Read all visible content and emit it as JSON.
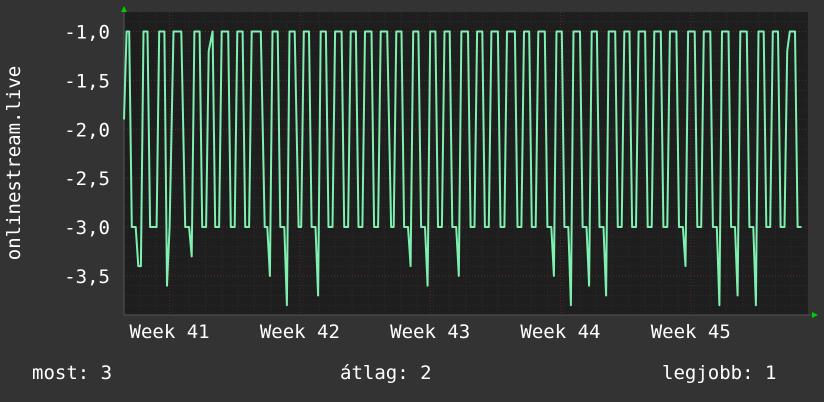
{
  "chart_data": {
    "type": "line",
    "ylabel": "onlinestream.live",
    "y_ticks": [
      {
        "value": -1.0,
        "label": "-1,0"
      },
      {
        "value": -1.5,
        "label": "-1,5"
      },
      {
        "value": -2.0,
        "label": "-2,0"
      },
      {
        "value": -2.5,
        "label": "-2,5"
      },
      {
        "value": -3.0,
        "label": "-3,0"
      },
      {
        "value": -3.5,
        "label": "-3,5"
      }
    ],
    "ylim": [
      -3.9,
      -0.8
    ],
    "xlim": [
      0,
      5.25
    ],
    "x_ticks": [
      {
        "value": 0.35,
        "label": "Week 41"
      },
      {
        "value": 1.35,
        "label": "Week 42"
      },
      {
        "value": 2.35,
        "label": "Week 43"
      },
      {
        "value": 3.35,
        "label": "Week 44"
      },
      {
        "value": 4.35,
        "label": "Week 45"
      }
    ],
    "grid": true,
    "colors": {
      "background": "#333333",
      "plot": "#1e1e1e",
      "line": "#7ef0b0",
      "grid_major": "#5a2a2a",
      "grid_minor": "#2c2c2c",
      "axis_arrow": "#00cc00"
    },
    "series": [
      {
        "values": [
          [
            0.0,
            -1.9
          ],
          [
            0.02,
            -1.0
          ],
          [
            0.04,
            -1.0
          ],
          [
            0.06,
            -3.0
          ],
          [
            0.09,
            -3.0
          ],
          [
            0.11,
            -3.4
          ],
          [
            0.13,
            -3.4
          ],
          [
            0.15,
            -1.0
          ],
          [
            0.18,
            -1.0
          ],
          [
            0.2,
            -3.0
          ],
          [
            0.25,
            -3.0
          ],
          [
            0.27,
            -1.0
          ],
          [
            0.31,
            -1.0
          ],
          [
            0.33,
            -3.6
          ],
          [
            0.35,
            -3.0
          ],
          [
            0.38,
            -1.0
          ],
          [
            0.44,
            -1.0
          ],
          [
            0.47,
            -3.0
          ],
          [
            0.5,
            -3.0
          ],
          [
            0.52,
            -3.3
          ],
          [
            0.54,
            -1.0
          ],
          [
            0.58,
            -1.0
          ],
          [
            0.6,
            -3.0
          ],
          [
            0.63,
            -3.0
          ],
          [
            0.65,
            -1.2
          ],
          [
            0.68,
            -1.0
          ],
          [
            0.7,
            -3.0
          ],
          [
            0.73,
            -3.0
          ],
          [
            0.75,
            -1.0
          ],
          [
            0.8,
            -1.0
          ],
          [
            0.82,
            -3.0
          ],
          [
            0.85,
            -3.0
          ],
          [
            0.87,
            -1.0
          ],
          [
            0.91,
            -1.0
          ],
          [
            0.93,
            -3.0
          ],
          [
            0.96,
            -3.0
          ],
          [
            0.98,
            -1.0
          ],
          [
            1.05,
            -1.0
          ],
          [
            1.08,
            -3.0
          ],
          [
            1.1,
            -3.0
          ],
          [
            1.12,
            -3.5
          ],
          [
            1.14,
            -1.0
          ],
          [
            1.18,
            -1.0
          ],
          [
            1.2,
            -3.0
          ],
          [
            1.23,
            -3.0
          ],
          [
            1.25,
            -3.8
          ],
          [
            1.27,
            -1.0
          ],
          [
            1.31,
            -1.0
          ],
          [
            1.34,
            -3.0
          ],
          [
            1.36,
            -3.0
          ],
          [
            1.38,
            -1.0
          ],
          [
            1.42,
            -1.0
          ],
          [
            1.44,
            -3.0
          ],
          [
            1.47,
            -3.0
          ],
          [
            1.49,
            -3.7
          ],
          [
            1.51,
            -1.0
          ],
          [
            1.55,
            -1.0
          ],
          [
            1.57,
            -3.0
          ],
          [
            1.6,
            -3.0
          ],
          [
            1.62,
            -1.0
          ],
          [
            1.67,
            -1.0
          ],
          [
            1.69,
            -3.0
          ],
          [
            1.72,
            -3.0
          ],
          [
            1.74,
            -1.0
          ],
          [
            1.78,
            -1.0
          ],
          [
            1.8,
            -3.0
          ],
          [
            1.83,
            -3.0
          ],
          [
            1.85,
            -1.0
          ],
          [
            1.9,
            -1.0
          ],
          [
            1.92,
            -3.0
          ],
          [
            1.95,
            -3.0
          ],
          [
            1.97,
            -1.0
          ],
          [
            2.02,
            -1.0
          ],
          [
            2.05,
            -3.0
          ],
          [
            2.07,
            -3.0
          ],
          [
            2.09,
            -1.0
          ],
          [
            2.13,
            -1.0
          ],
          [
            2.15,
            -3.0
          ],
          [
            2.18,
            -3.0
          ],
          [
            2.2,
            -3.4
          ],
          [
            2.22,
            -1.0
          ],
          [
            2.26,
            -1.0
          ],
          [
            2.28,
            -3.0
          ],
          [
            2.31,
            -3.0
          ],
          [
            2.33,
            -3.6
          ],
          [
            2.35,
            -1.0
          ],
          [
            2.39,
            -1.0
          ],
          [
            2.41,
            -3.0
          ],
          [
            2.44,
            -3.0
          ],
          [
            2.46,
            -1.0
          ],
          [
            2.5,
            -1.0
          ],
          [
            2.52,
            -3.0
          ],
          [
            2.55,
            -3.0
          ],
          [
            2.57,
            -3.5
          ],
          [
            2.59,
            -1.0
          ],
          [
            2.64,
            -1.0
          ],
          [
            2.66,
            -3.0
          ],
          [
            2.69,
            -3.0
          ],
          [
            2.71,
            -1.0
          ],
          [
            2.75,
            -1.0
          ],
          [
            2.77,
            -3.0
          ],
          [
            2.8,
            -3.0
          ],
          [
            2.82,
            -1.0
          ],
          [
            2.87,
            -1.0
          ],
          [
            2.89,
            -3.0
          ],
          [
            2.92,
            -3.0
          ],
          [
            2.94,
            -1.0
          ],
          [
            3.0,
            -1.0
          ],
          [
            3.02,
            -3.0
          ],
          [
            3.05,
            -3.0
          ],
          [
            3.07,
            -1.0
          ],
          [
            3.11,
            -1.0
          ],
          [
            3.13,
            -3.0
          ],
          [
            3.16,
            -3.0
          ],
          [
            3.18,
            -1.0
          ],
          [
            3.23,
            -1.0
          ],
          [
            3.25,
            -3.0
          ],
          [
            3.28,
            -3.0
          ],
          [
            3.3,
            -3.5
          ],
          [
            3.32,
            -1.0
          ],
          [
            3.36,
            -1.0
          ],
          [
            3.38,
            -3.0
          ],
          [
            3.41,
            -3.0
          ],
          [
            3.43,
            -3.8
          ],
          [
            3.45,
            -1.0
          ],
          [
            3.5,
            -1.0
          ],
          [
            3.52,
            -3.0
          ],
          [
            3.55,
            -3.0
          ],
          [
            3.57,
            -3.6
          ],
          [
            3.59,
            -1.0
          ],
          [
            3.63,
            -1.0
          ],
          [
            3.65,
            -3.0
          ],
          [
            3.68,
            -3.0
          ],
          [
            3.7,
            -3.7
          ],
          [
            3.72,
            -1.0
          ],
          [
            3.77,
            -1.0
          ],
          [
            3.79,
            -3.0
          ],
          [
            3.82,
            -3.0
          ],
          [
            3.84,
            -1.0
          ],
          [
            3.88,
            -1.0
          ],
          [
            3.9,
            -3.0
          ],
          [
            3.93,
            -3.0
          ],
          [
            3.95,
            -1.0
          ],
          [
            4.0,
            -1.0
          ],
          [
            4.02,
            -3.0
          ],
          [
            4.05,
            -3.0
          ],
          [
            4.07,
            -1.0
          ],
          [
            4.12,
            -1.0
          ],
          [
            4.14,
            -3.0
          ],
          [
            4.17,
            -3.0
          ],
          [
            4.19,
            -1.0
          ],
          [
            4.24,
            -1.0
          ],
          [
            4.26,
            -3.0
          ],
          [
            4.29,
            -3.0
          ],
          [
            4.31,
            -3.4
          ],
          [
            4.33,
            -1.0
          ],
          [
            4.38,
            -1.0
          ],
          [
            4.4,
            -3.0
          ],
          [
            4.43,
            -3.0
          ],
          [
            4.45,
            -1.0
          ],
          [
            4.5,
            -1.0
          ],
          [
            4.52,
            -3.0
          ],
          [
            4.55,
            -3.0
          ],
          [
            4.57,
            -3.8
          ],
          [
            4.59,
            -1.0
          ],
          [
            4.64,
            -1.0
          ],
          [
            4.66,
            -3.0
          ],
          [
            4.69,
            -3.0
          ],
          [
            4.71,
            -3.7
          ],
          [
            4.73,
            -1.0
          ],
          [
            4.78,
            -1.0
          ],
          [
            4.8,
            -3.0
          ],
          [
            4.83,
            -3.0
          ],
          [
            4.85,
            -3.8
          ],
          [
            4.87,
            -1.0
          ],
          [
            4.91,
            -1.0
          ],
          [
            4.93,
            -3.0
          ],
          [
            4.96,
            -3.0
          ],
          [
            4.98,
            -1.0
          ],
          [
            5.02,
            -1.0
          ],
          [
            5.04,
            -3.0
          ],
          [
            5.07,
            -3.0
          ],
          [
            5.09,
            -1.2
          ],
          [
            5.11,
            -1.0
          ],
          [
            5.15,
            -1.0
          ],
          [
            5.17,
            -3.0
          ],
          [
            5.2,
            -3.0
          ]
        ]
      }
    ]
  },
  "legend": {
    "current": "most: 3",
    "average": "átlag: 2",
    "max": "legjobb: 1"
  }
}
